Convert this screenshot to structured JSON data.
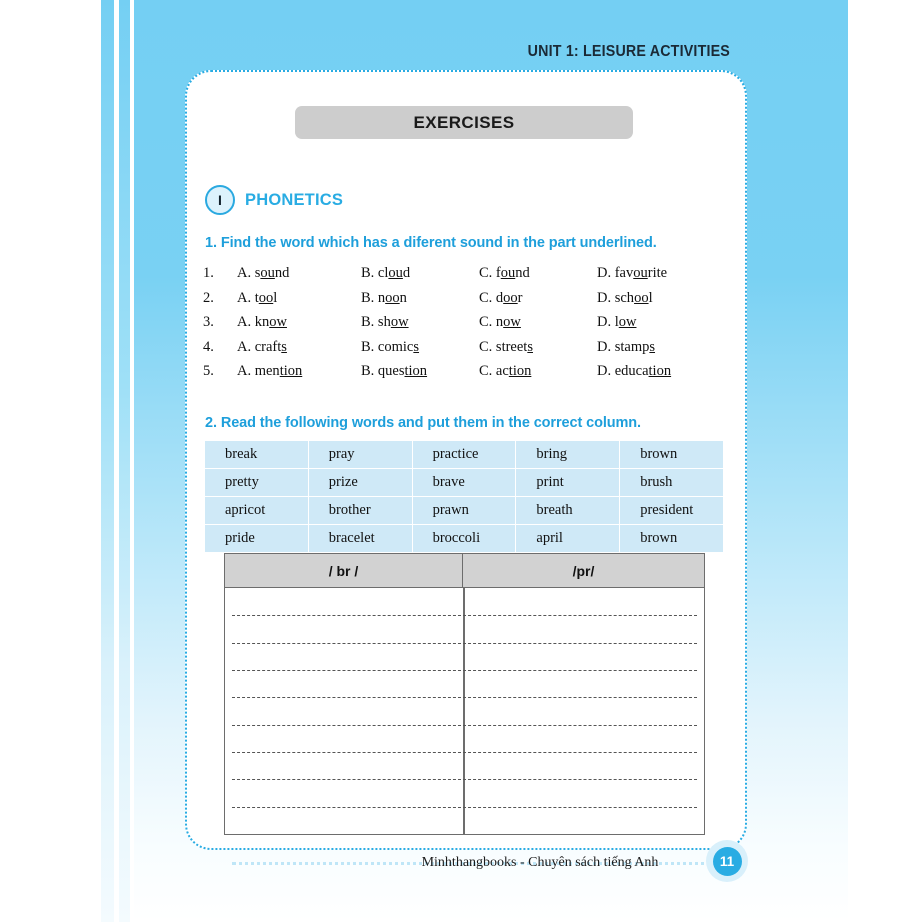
{
  "header": {
    "unit_title": "UNIT 1: LEISURE ACTIVITIES"
  },
  "banner": {
    "title": "EXERCISES"
  },
  "section": {
    "roman": "I",
    "title": "PHONETICS"
  },
  "exercise1": {
    "prompt": "1. Find the word which has a diferent sound in the part underlined.",
    "rows": [
      {
        "number": "1.",
        "options": [
          {
            "label": "A. ",
            "pre": "s",
            "mid": "ou",
            "post": "nd"
          },
          {
            "label": "B. ",
            "pre": "cl",
            "mid": "ou",
            "post": "d"
          },
          {
            "label": "C. ",
            "pre": "f",
            "mid": "ou",
            "post": "nd"
          },
          {
            "label": "D. ",
            "pre": "fav",
            "mid": "ou",
            "post": "rite"
          }
        ]
      },
      {
        "number": "2.",
        "options": [
          {
            "label": "A. ",
            "pre": "t",
            "mid": "oo",
            "post": "l"
          },
          {
            "label": "B. ",
            "pre": "n",
            "mid": "oo",
            "post": "n"
          },
          {
            "label": "C. ",
            "pre": "d",
            "mid": "oo",
            "post": "r"
          },
          {
            "label": "D. ",
            "pre": "sch",
            "mid": "oo",
            "post": "l"
          }
        ]
      },
      {
        "number": "3.",
        "options": [
          {
            "label": "A. ",
            "pre": "kn",
            "mid": "ow",
            "post": ""
          },
          {
            "label": "B. ",
            "pre": "sh",
            "mid": "ow",
            "post": ""
          },
          {
            "label": "C. ",
            "pre": "n",
            "mid": "ow",
            "post": ""
          },
          {
            "label": "D. ",
            "pre": "l",
            "mid": "ow",
            "post": ""
          }
        ]
      },
      {
        "number": "4.",
        "options": [
          {
            "label": "A. ",
            "pre": "craft",
            "mid": "s",
            "post": ""
          },
          {
            "label": "B. ",
            "pre": "comic",
            "mid": "s",
            "post": ""
          },
          {
            "label": "C. ",
            "pre": "street",
            "mid": "s",
            "post": ""
          },
          {
            "label": "D. ",
            "pre": "stamp",
            "mid": "s",
            "post": ""
          }
        ]
      },
      {
        "number": "5.",
        "options": [
          {
            "label": "A. ",
            "pre": "men",
            "mid": "tion",
            "post": ""
          },
          {
            "label": "B. ",
            "pre": "ques",
            "mid": "tion",
            "post": ""
          },
          {
            "label": "C. ",
            "pre": "ac",
            "mid": "tion",
            "post": ""
          },
          {
            "label": "D. ",
            "pre": "educa",
            "mid": "tion",
            "post": ""
          }
        ]
      }
    ]
  },
  "exercise2": {
    "prompt": "2. Read the following words and put them in the correct column.",
    "wordbank": [
      [
        "break",
        "pray",
        "practice",
        "bring",
        "brown"
      ],
      [
        "pretty",
        "prize",
        "brave",
        "print",
        "brush"
      ],
      [
        "apricot",
        "brother",
        "prawn",
        "breath",
        "president"
      ],
      [
        "pride",
        "bracelet",
        "broccoli",
        "april",
        "brown"
      ]
    ],
    "answer_table": {
      "headers": [
        "/ br /",
        "/pr/"
      ],
      "blank_lines": 8
    }
  },
  "footer": {
    "text": "Minhthangbooks - Chuyên sách tiếng Anh",
    "page_number": "11"
  },
  "colors": {
    "page_blue": "#74cff3",
    "accent_blue": "#29ace3",
    "prompt_blue": "#1e9fdb",
    "wordbank_fill": "#cfe9f7",
    "banner_gray": "#cdcdcd",
    "table_header_gray": "#d2d2d2"
  }
}
